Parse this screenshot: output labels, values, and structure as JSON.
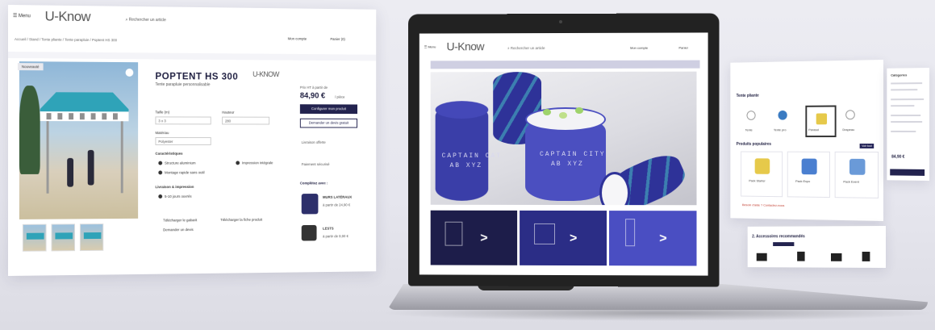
{
  "left": {
    "menu_label": "☰ Menu",
    "logo": "U-Know",
    "search_placeholder": "Rechercher un article",
    "breadcrumb": "Accueil / Stand / Tente pliante / Tente parapluie / Poptent HS 300",
    "login_label": "Mon compte",
    "cart_label": "Panier (0)",
    "badge": "Nouveauté",
    "product_title": "POPTENT HS 300",
    "product_subtitle": "Tente parapluie personnalisable",
    "brand": "U-KNOW",
    "options": [
      {
        "label": "Taille (m)",
        "value": "3 x 3"
      },
      {
        "label": "Hauteur",
        "value": "280"
      },
      {
        "label": "Matériau",
        "value": "Polyester"
      },
      {
        "label": "Quantité",
        "value": "1"
      }
    ],
    "features_title": "Caractéristiques",
    "features": [
      "Structure aluminium",
      "Impression intégrale",
      "Montage rapide sans outil",
      "Sac de transport inclus"
    ],
    "delivery_title": "Livraison & impression",
    "delivery_item": "5-10 jours ouvrés",
    "links": [
      "Télécharger le gabarit",
      "Télécharger la fiche produit",
      "Demander un devis"
    ],
    "price_label": "Prix HT à partir de",
    "price": "84,90 €",
    "price_unit": "/ pièce",
    "buy_button": "Configurer mon produit",
    "quote_button": "Demander un devis gratuit",
    "shipping_note": "Livraison offerte",
    "payment_note": "Paiement sécurisé",
    "accessories_title": "Complétez avec :",
    "accessories": [
      {
        "title": "MURS LATÉRAUX",
        "price": "à partir de 24,90 €"
      },
      {
        "title": "LESTS",
        "price": "à partir de 9,90 €"
      }
    ]
  },
  "laptop": {
    "menu_label": "☰ Menu",
    "logo": "U-Know",
    "search_placeholder": "Rechercher un article",
    "login_label": "Mon compte",
    "cart_label": "Panier",
    "pouf_text_1": "CAPTAIN CAT",
    "pouf_text_1b": "AB XYZ",
    "pouf_text_2": "CAPTAIN CITY",
    "pouf_text_2b": "AB XYZ",
    "tile_arrows": [
      ">",
      ">",
      ">"
    ]
  },
  "right": {
    "section_title": "Tente pliante",
    "categories": [
      "Tente",
      "Tente pro",
      "Parasol",
      "Drapeau"
    ],
    "promo_title": "Produits populaires",
    "promo_badge": "Voir tout",
    "promo_cards": [
      "Pack Starter",
      "Pack Expo",
      "Pack Event"
    ],
    "note": "Besoin d'aide ? Contactez-nous",
    "bottom_title": "2. Accessoires recommandés",
    "side_price": "84,90 €",
    "side_menu_title": "Catégories"
  },
  "colors": {
    "navy": "#23234f",
    "accent": "#3b3ea8",
    "teal": "#2fa3b8"
  }
}
